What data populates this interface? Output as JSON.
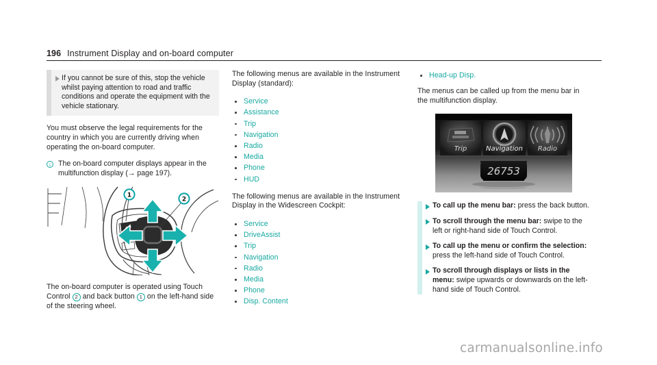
{
  "header": {
    "page_number": "196",
    "chapter_title": "Instrument Display and on-board computer"
  },
  "column1": {
    "warning_box": {
      "icon": "triangle-right-icon",
      "text": "If you cannot be sure of this, stop the vehicle whilst paying attention to road and traffic conditions and operate the equipment with the vehicle stationary."
    },
    "paragraph_legal": "You must observe the legal requirements for the country in which you are currently driving when operating the on-board computer.",
    "note": {
      "icon": "info-circle-icon",
      "text": "The on-board computer displays appear in the multifunction display (→ page 197)."
    },
    "figure": {
      "name": "steering-wheel-touch-control-illustration",
      "callout_1": "1",
      "callout_2": "2"
    },
    "paragraph_operation_pre": "The on-board computer is operated using Touch Control ",
    "paragraph_operation_mid": " and back button ",
    "paragraph_operation_post": " on the left-hand side of the steering wheel.",
    "callout_2_label": "2",
    "callout_1_label": "1"
  },
  "column2": {
    "intro_standard": "The following menus are available in the Instrument Display (standard):",
    "menus_standard": [
      "Service",
      "Assistance",
      "Trip",
      "Navigation",
      "Radio",
      "Media",
      "Phone",
      "HUD"
    ],
    "intro_widescreen": "The following menus are available in the Instrument Display in the Widescreen Cockpit:",
    "menus_widescreen": [
      "Service",
      "DriveAssist",
      "Trip",
      "Navigation",
      "Radio",
      "Media",
      "Phone",
      "Disp. Content"
    ]
  },
  "column3": {
    "menus_widescreen_continued": [
      "Head-up Disp."
    ],
    "paragraph_menubar": "The menus can be called up from the menu bar in the multifunction display.",
    "figure": {
      "name": "instrument-display-menu-bar-photo",
      "menu_items": [
        "Trip",
        "Navigation",
        "Radio"
      ],
      "odometer": "26753"
    },
    "steps": [
      {
        "bold": "To call up the menu bar:",
        "rest": " press the back button."
      },
      {
        "bold": "To scroll through the menu bar:",
        "rest": " swipe to the left or right-hand side of Touch Control."
      },
      {
        "bold": "To call up the menu or confirm the selection:",
        "rest": " press the left-hand side of Touch Control."
      },
      {
        "bold": "To scroll through displays or lists in the menu:",
        "rest": " swipe upwards or downwards on the left-hand side of Touch Control."
      }
    ]
  },
  "watermark": "carmanualsonline.info",
  "colors": {
    "accent_teal": "#16a8a0",
    "accent_teal_light": "#d2f0ee",
    "text": "#231f20",
    "grey_box_bg": "#f2f2f2",
    "grey_box_bar": "#dcdcdc"
  }
}
